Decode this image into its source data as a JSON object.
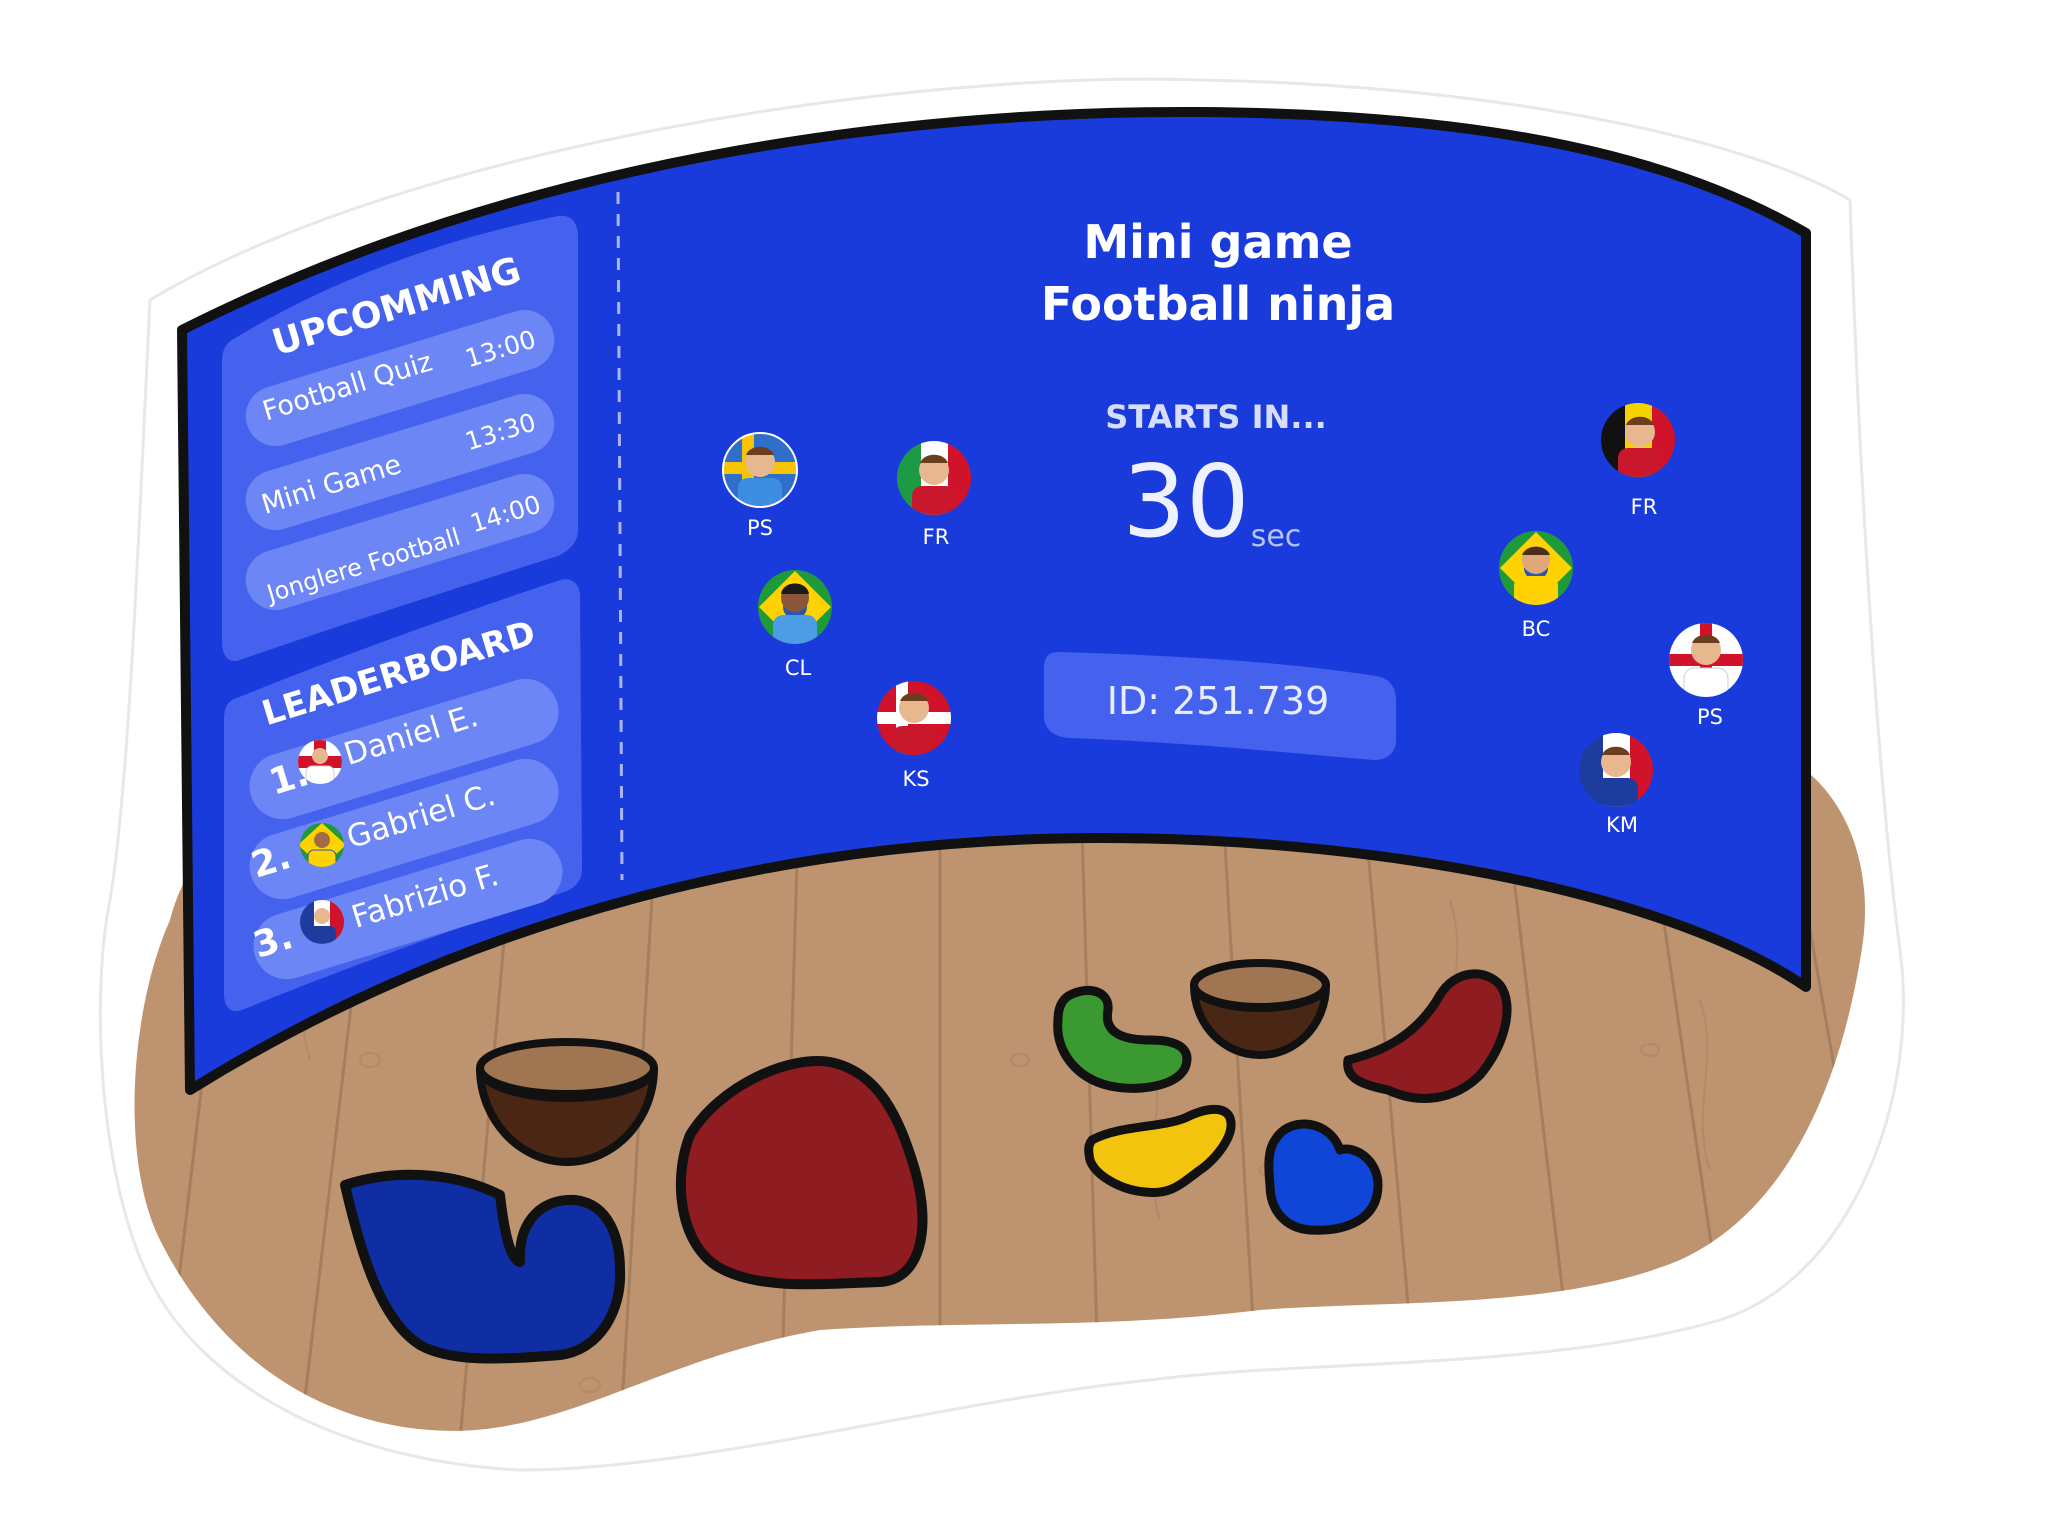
{
  "colors": {
    "screen": "#1a3bdb",
    "panel": "#4562ee",
    "pill": "#6d86f5",
    "floor": "#bb9270",
    "outline": "#111111"
  },
  "game": {
    "title_line1": "Mini game",
    "title_line2": "Football ninja",
    "starts_label": "STARTS IN...",
    "countdown_value": "30",
    "countdown_unit": "sec",
    "session_id": "ID: 251.739"
  },
  "upcoming": {
    "heading": "UPCOMMING",
    "items": [
      {
        "name": "Football Quiz",
        "time": "13:00"
      },
      {
        "name": "Mini Game",
        "time": "13:30"
      },
      {
        "name": "Jonglere Football",
        "time": "14:00"
      }
    ]
  },
  "leaderboard": {
    "heading": "LEADERBOARD",
    "entries": [
      {
        "rank": "1.",
        "name": "Daniel E.",
        "flag": "england-flag-avatar"
      },
      {
        "rank": "2.",
        "name": "Gabriel C.",
        "flag": "brazil-flag-avatar"
      },
      {
        "rank": "3.",
        "name": "Fabrizio F.",
        "flag": "france-flag-avatar"
      }
    ]
  },
  "players": [
    {
      "initials": "PS",
      "flag": "sweden-flag-avatar"
    },
    {
      "initials": "FR",
      "flag": "italy-flag-avatar"
    },
    {
      "initials": "CL",
      "flag": "brazil-flag-avatar"
    },
    {
      "initials": "KS",
      "flag": "denmark-flag-avatar"
    },
    {
      "initials": "FR",
      "flag": "belgium-flag-avatar"
    },
    {
      "initials": "BC",
      "flag": "brazil-flag-avatar"
    },
    {
      "initials": "PS",
      "flag": "england-flag-avatar"
    },
    {
      "initials": "KM",
      "flag": "france-flag-avatar"
    }
  ],
  "floor_objects": [
    "brown-bowl-target",
    "red-blob-pad",
    "blue-seat-pad",
    "green-curve-pad",
    "brown-bowl-target-2",
    "red-wing-pad",
    "yellow-wing-pad",
    "blue-heart-pad"
  ]
}
